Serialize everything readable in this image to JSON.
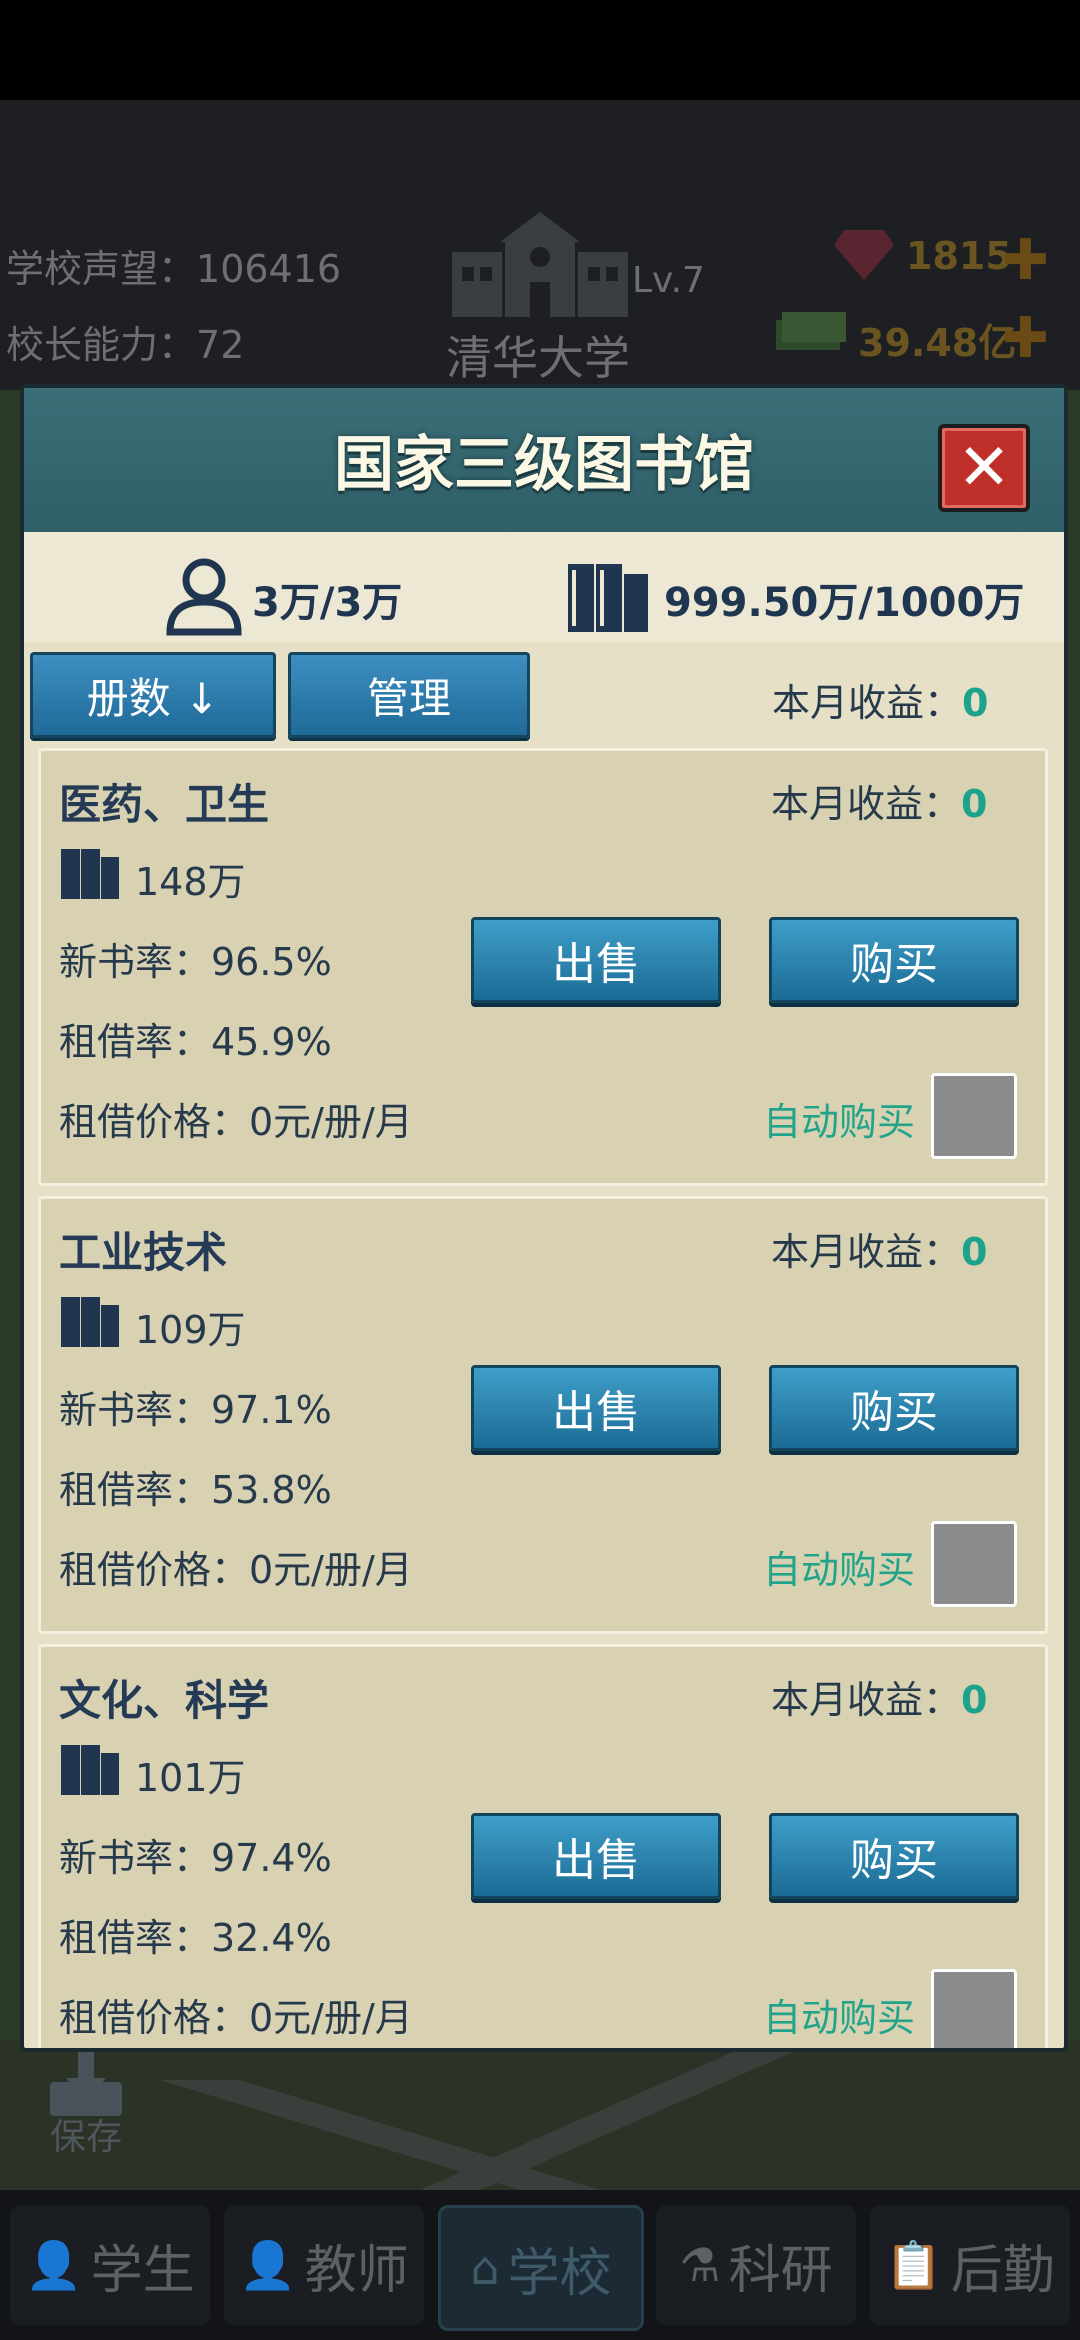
{
  "header": {
    "reputation_label": "学校声望：",
    "reputation_value": "106416",
    "principal_label": "校长能力：",
    "principal_value": "72",
    "school_name": "清华大学",
    "level": "Lv.7",
    "gems": "1815",
    "money": "39.48亿"
  },
  "dialog": {
    "title": "国家三级图书馆",
    "close_label": "✕",
    "readers": "3万/3万",
    "books_capacity": "999.50万/1000万",
    "sort_label": "册数 ↓",
    "manage_label": "管理",
    "income_label": "本月收益：",
    "income_value": "0",
    "categories": [
      {
        "name": "医药、卫生",
        "income_label": "本月收益：",
        "income": "0",
        "count": "148万",
        "new_rate": "新书率：96.5%",
        "rent_rate": "租借率：45.9%",
        "price": "租借价格：0元/册/月",
        "sell": "出售",
        "buy": "购买",
        "auto": "自动购买"
      },
      {
        "name": "工业技术",
        "income_label": "本月收益：",
        "income": "0",
        "count": "109万",
        "new_rate": "新书率：97.1%",
        "rent_rate": "租借率：53.8%",
        "price": "租借价格：0元/册/月",
        "sell": "出售",
        "buy": "购买",
        "auto": "自动购买"
      },
      {
        "name": "文化、科学",
        "income_label": "本月收益：",
        "income": "0",
        "count": "101万",
        "new_rate": "新书率：97.4%",
        "rent_rate": "租借率：32.4%",
        "price": "租借价格：0元/册/月",
        "sell": "出售",
        "buy": "购买",
        "auto": "自动购买"
      }
    ]
  },
  "save_label": "保存",
  "nav": [
    "学生",
    "教师",
    "学校",
    "科研",
    "后勤"
  ],
  "colors": {
    "accent": "#1fa28c",
    "button": "#2a82b4",
    "title_bar": "#3b6f78"
  }
}
